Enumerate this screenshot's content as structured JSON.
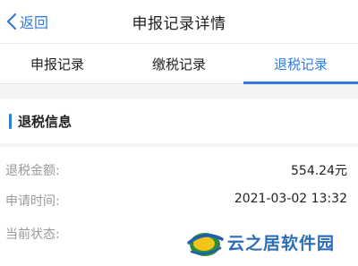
{
  "navbar": {
    "back_label": "返回",
    "title": "申报记录详情"
  },
  "tabs": [
    {
      "label": "申报记录",
      "active": false
    },
    {
      "label": "缴税记录",
      "active": false
    },
    {
      "label": "退税记录",
      "active": true
    }
  ],
  "section": {
    "title": "退税信息"
  },
  "details": [
    {
      "label": "退税金额:",
      "value": "554.24元"
    },
    {
      "label": "申请时间:",
      "value": "2021-03-02 13:32"
    },
    {
      "label": "当前状态:",
      "value": ""
    }
  ],
  "watermark": {
    "text": "云之居软件园"
  },
  "colors": {
    "accent": "#2f7ce0",
    "label": "#9a9a9a",
    "background": "#f3f4f6"
  }
}
